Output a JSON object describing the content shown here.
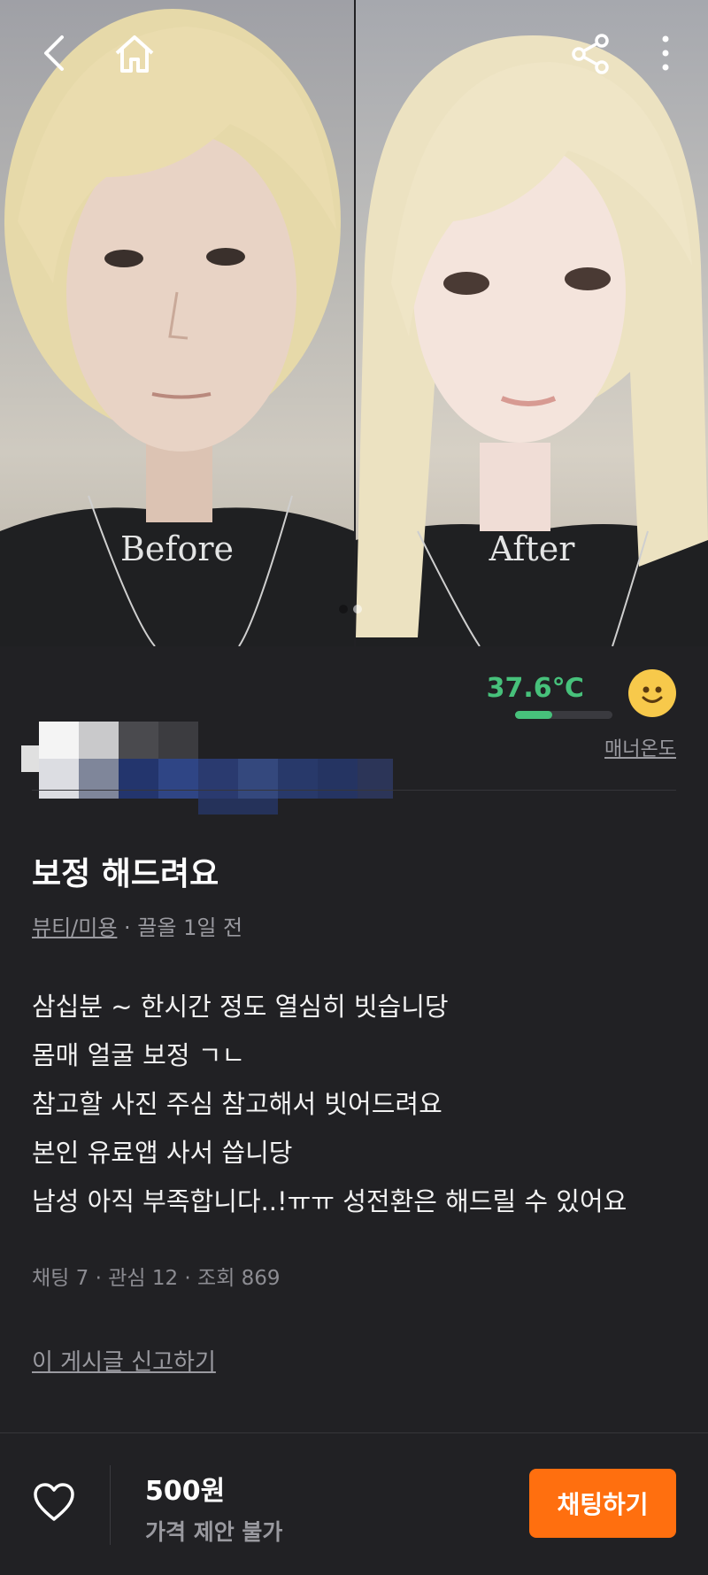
{
  "topbar": {
    "back_icon": "chevron-left-icon",
    "home_icon": "home-icon",
    "share_icon": "share-icon",
    "more_icon": "more-vertical-icon"
  },
  "hero": {
    "before_label": "Before",
    "after_label": "After",
    "carousel": {
      "total": 2,
      "active": 2
    }
  },
  "seller": {
    "manner_temp": "37.6℃",
    "manner_temp_level": 0.38,
    "manner_label": "매너온도",
    "temp_color": "#47c17b",
    "face_icon": "smile-face-icon"
  },
  "post": {
    "title": "보정 해드려요",
    "category": "뷰티/미용",
    "meta_rest": " · 끌올 1일 전",
    "description": [
      "삼십분 ~ 한시간 정도 열심히 빗습니당",
      "몸매 얼굴 보정 ㄱㄴ",
      "참고할 사진 주심 참고해서 빗어드려요",
      "본인 유료앱 사서 씁니당",
      "남성 아직 부족합니다..!ㅠㅠ 성전환은 해드릴 수 있어요"
    ],
    "stats": "채팅 7 · 관심 12 · 조회 869",
    "report_link": "이 게시글 신고하기"
  },
  "bottom": {
    "heart_icon": "heart-outline-icon",
    "price": "500원",
    "negotiation": "가격 제안 불가",
    "chat_button": "채팅하기",
    "accent": "#ff6f0f"
  }
}
